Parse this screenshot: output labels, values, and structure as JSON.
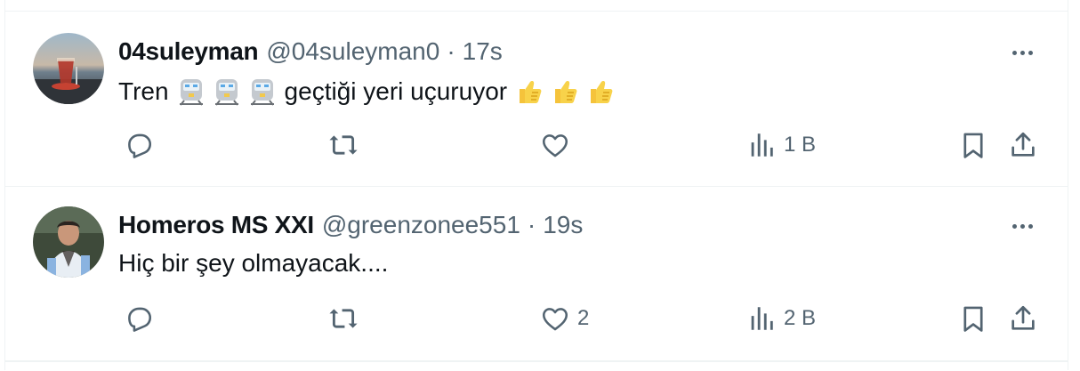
{
  "tweets": [
    {
      "name": "04suleyman",
      "handle": "@04suleyman0",
      "separator": "·",
      "time": "17s",
      "text_before": "Tren",
      "emoji_group_1": [
        "train-emoji",
        "train-emoji",
        "train-emoji"
      ],
      "text_after": "geçtiği yeri uçuruyor",
      "emoji_group_2": [
        "thumbs-up-emoji",
        "thumbs-up-emoji",
        "thumbs-up-emoji"
      ],
      "replies": "",
      "retweets": "",
      "likes": "",
      "views": "1 B"
    },
    {
      "name": "Homeros MS XXI",
      "handle": "@greenzonee551",
      "separator": "·",
      "time": "19s",
      "text": "Hiç bir şey olmayacak....",
      "replies": "",
      "retweets": "",
      "likes": "2",
      "views": "2 B"
    }
  ],
  "colors": {
    "primary_text": "#0f1419",
    "secondary_text": "#536471",
    "border": "#eff3f4",
    "emoji_yellow": "#f5c33b"
  }
}
